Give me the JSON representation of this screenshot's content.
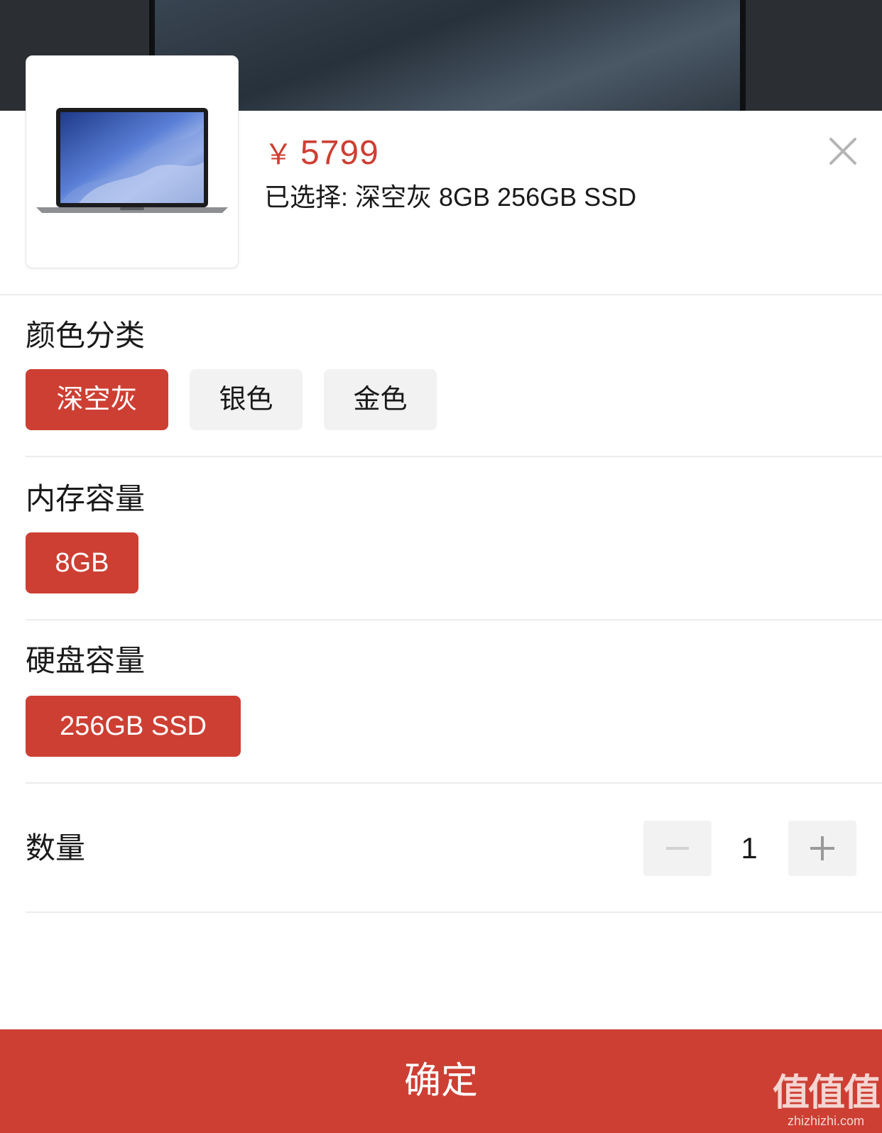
{
  "product": {
    "currency": "￥",
    "price": "5799",
    "selected_text": "已选择: 深空灰 8GB 256GB SSD",
    "thumbnail_icon": "laptop-image"
  },
  "sections": {
    "color": {
      "title": "颜色分类",
      "options": [
        "深空灰",
        "银色",
        "金色"
      ],
      "selected": "深空灰"
    },
    "memory": {
      "title": "内存容量",
      "options": [
        "8GB"
      ],
      "selected": "8GB"
    },
    "storage": {
      "title": "硬盘容量",
      "options": [
        "256GB SSD"
      ],
      "selected": "256GB SSD"
    }
  },
  "quantity": {
    "label": "数量",
    "value": "1",
    "decrease_icon": "minus-icon",
    "increase_icon": "plus-icon"
  },
  "confirm_label": "确定",
  "watermark": {
    "main": "值值值",
    "sub": "zhizhizhi.com"
  },
  "colors": {
    "accent": "#cd3f33",
    "option_bg": "#f2f2f2",
    "divider": "#ececec"
  }
}
